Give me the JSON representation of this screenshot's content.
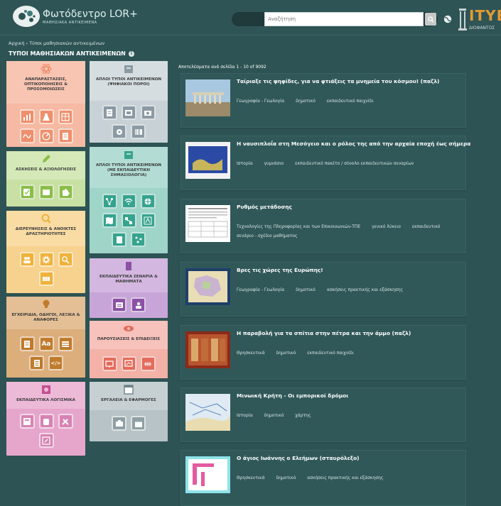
{
  "header": {
    "logo_title": "Φωτόδεντρο LOR+",
    "logo_subtitle": "ΜΑΘΗΣΙΑΚΑ ΑΝΤΙΚΕΙΜΕΝΑ",
    "search_placeholder": "Αναζήτηση",
    "org_logo": "ITYE",
    "org_sub": "ΔΙΟΦΑΝΤΟΣ"
  },
  "breadcrumb": "Αρχική › Τύποι μαθησιακών αντικειμένων",
  "page_title": "ΤΥΠΟΙ ΜΑΘΗΣΙΑΚΩΝ ΑΝΤΙΚΕΙΜΕΝΩΝ",
  "results_count": "Αποτελέσματα ανά σελίδα   1 - 10 of 9092",
  "categories": [
    {
      "label": "ΑΝΑΠΑΡΑΣΤΑΣΕΙΣ, ΟΠΤΙΚΟΠΟΙΗΣΕΙΣ & ΠΡΟΣΟΜΟΙΩΣΕΙΣ",
      "color": "#ef8f6c",
      "bg": "#f6b9a3",
      "icon": "atom-icon"
    },
    {
      "label": "ΑΣΚΗΣΕΙΣ & ΑΞΙΟΛΟΓΗΣΕΙΣ",
      "color": "#8bbd48",
      "bg": "#c8e0a4",
      "icon": "pencil-icon"
    },
    {
      "label": "ΔΙΕΡΕΥΝΗΣΕΙΣ & ΑΝΟΙΚΤΕΣ ΔΡΑΣΤΗΡΙΟΤΗΤΕΣ",
      "color": "#f0b23c",
      "bg": "#f7d28e",
      "icon": "magnifier-icon"
    },
    {
      "label": "ΕΓΧΕΙΡΙΔΙΑ, ΟΔΗΓΟΙ, ΛΕΞΙΚΑ & ΑΝΑΦΟΡΕΣ",
      "color": "#c07b2d",
      "bg": "#dcae7c",
      "icon": "bulb-icon"
    },
    {
      "label": "ΕΚΠΑΙΔΕΥΤΙΚΑ ΛΟΓΙΣΜΙΚΑ",
      "color": "#c44f93",
      "bg": "#e6a6cb",
      "icon": "software-icon"
    },
    {
      "label": "ΑΠΛΟΙ ΤΥΠΟΙ ΑΝΤΙΚΕΙΜΕΝΩΝ (ΨΗΦΙΑΚΟΙ ΠΟΡΟΙ)",
      "color": "#8b9aa3",
      "bg": "#c8d1d6",
      "icon": "box-icon"
    },
    {
      "label": "ΑΠΛΟΙ ΤΥΠΟΙ ΑΝΤΙΚΕΙΜΕΝΩΝ (ΜΕ ΕΚΠΑΙΔΕΥΤΙΚΗ ΣΗΜΑΣΙΟΛΟΓΙΑ)",
      "color": "#36a38e",
      "bg": "#9fd4c9",
      "icon": "box-icon"
    },
    {
      "label": "ΕΚΠΑΙΔΕΥΤΙΚΑ ΣΕΝΑΡΙΑ & ΜΑΘΗΜΑΤΑ",
      "color": "#8b51a5",
      "bg": "#c8a5d8",
      "icon": "scroll-icon"
    },
    {
      "label": "ΠΑΡΟΥΣΙΑΣΕΙΣ & ΕΠΙΔΕΙΞΕΙΣ",
      "color": "#e56b5b",
      "bg": "#f3b1a8",
      "icon": "eye-icon"
    },
    {
      "label": "ΕΡΓΑΛΕΙΑ & ΕΦΑΡΜΟΓΕΣ",
      "color": "#6f8288",
      "bg": "#b7c3c6",
      "icon": "window-icon"
    }
  ],
  "results": [
    {
      "title": "Ταίριαξε τις ψηφίδες, για να φτιάξεις τα μνημεία του κόσμου! (παζλ)",
      "tags": [
        "Γεωγραφία - Γεωλογία",
        "δημοτικό",
        "εκπαιδευτικό παιχνίδι"
      ]
    },
    {
      "title": "Η ναυσιπλοΐα στη Μεσόγειο και ο ρόλος της από την αρχαία εποχή έως σήμερα",
      "tags": [
        "Ιστορία",
        "γυμνάσιο",
        "εκπαιδευτικό πακέτο / σύνολο εκπαιδευτικών σεναρίων"
      ]
    },
    {
      "title": "Ρυθμός μετάδοσης",
      "tags": [
        "Τεχνολογίες της Πληροφορίας και των Επικοινωνιών-ΤΠΕ",
        "γενικό λύκειο",
        "εκπαιδευτικό σενάριο - σχέδιο μαθήματος"
      ]
    },
    {
      "title": "Βρες τις χώρες της Ευρώπης!",
      "tags": [
        "Γεωγραφία - Γεωλογία",
        "δημοτικό",
        "ασκήσεις πρακτικής και εξάσκησης"
      ]
    },
    {
      "title": "Η παραβολή για τα σπίτια στην πέτρα και την άμμο (παζλ)",
      "tags": [
        "Θρησκευτικά",
        "δημοτικό",
        "εκπαιδευτικό παιχνίδι"
      ]
    },
    {
      "title": "Μινωική Κρήτη - Οι εμπορικοί δρόμοι",
      "tags": [
        "Ιστορία",
        "δημοτικό",
        "χάρτης"
      ]
    },
    {
      "title": "Ο άγιος Ιωάννης ο Ελεήμων (σταυρόλεξο)",
      "tags": [
        "Θρησκευτικά",
        "δημοτικό",
        "ασκήσεις πρακτικής και εξάσκησης"
      ]
    }
  ]
}
